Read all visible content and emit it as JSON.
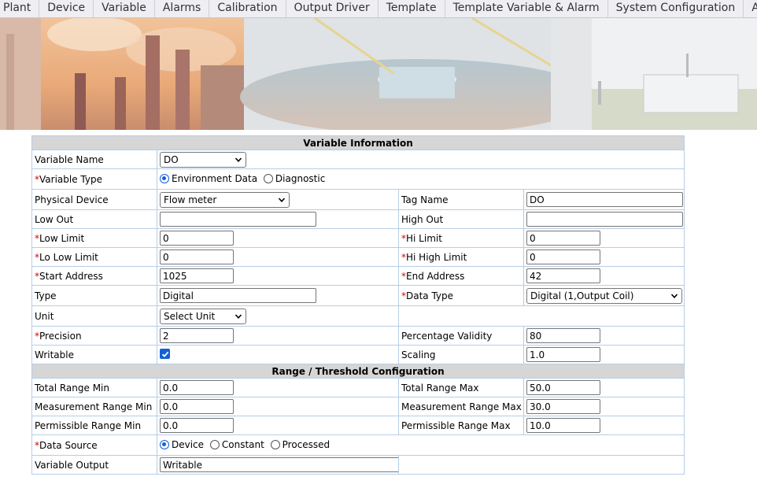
{
  "nav": {
    "items": [
      "Plant",
      "Device",
      "Variable",
      "Alarms",
      "Calibration",
      "Output Driver",
      "Template",
      "Template Variable & Alarm",
      "System Configuration",
      "Admin Con"
    ]
  },
  "sections": {
    "variable_info": "Variable Information",
    "range_threshold": "Range / Threshold Configuration"
  },
  "fields": {
    "variable_name": {
      "label": "Variable Name",
      "value": "DO"
    },
    "variable_type": {
      "label": "Variable Type",
      "options": [
        "Environment Data",
        "Diagnostic"
      ],
      "selected": "Environment Data"
    },
    "physical_device": {
      "label": "Physical Device",
      "value": "Flow meter"
    },
    "tag_name": {
      "label": "Tag Name",
      "value": "DO"
    },
    "low_out": {
      "label": "Low Out",
      "value": ""
    },
    "high_out": {
      "label": "High Out",
      "value": ""
    },
    "low_limit": {
      "label": "Low Limit",
      "value": "0"
    },
    "hi_limit": {
      "label": "Hi Limit",
      "value": "0"
    },
    "lo_low_limit": {
      "label": "Lo Low Limit",
      "value": "0"
    },
    "hi_high_limit": {
      "label": "Hi High Limit",
      "value": "0"
    },
    "start_address": {
      "label": "Start Address",
      "value": "1025"
    },
    "end_address": {
      "label": "End Address",
      "value": "42"
    },
    "type": {
      "label": "Type",
      "value": "Digital"
    },
    "data_type": {
      "label": "Data Type",
      "value": "Digital (1,Output Coil)"
    },
    "unit": {
      "label": "Unit",
      "value": "Select Unit"
    },
    "precision": {
      "label": "Precision",
      "value": "2"
    },
    "percentage_validity": {
      "label": "Percentage Validity",
      "value": "80"
    },
    "writable": {
      "label": "Writable",
      "checked": true
    },
    "scaling": {
      "label": "Scaling",
      "value": "1.0"
    },
    "total_range_min": {
      "label": "Total Range Min",
      "value": "0.0"
    },
    "total_range_max": {
      "label": "Total Range Max",
      "value": "50.0"
    },
    "measurement_range_min": {
      "label": "Measurement Range Min",
      "value": "0.0"
    },
    "measurement_range_max": {
      "label": "Measurement Range Max",
      "value": "30.0"
    },
    "permissible_range_min": {
      "label": "Permissible Range Min",
      "value": "0.0"
    },
    "permissible_range_max": {
      "label": "Permissible Range Max",
      "value": "10.0"
    },
    "data_source": {
      "label": "Data Source",
      "options": [
        "Device",
        "Constant",
        "Processed"
      ],
      "selected": "Device"
    },
    "variable_output": {
      "label": "Variable Output",
      "value": "Writable"
    }
  },
  "required_marker": "*",
  "icons": {
    "dropdown": "chevron-down-icon",
    "radio": "radio-icon",
    "checkbox": "checkmark-icon"
  },
  "colors": {
    "accent": "#1560d3",
    "required": "#dd0000",
    "section_bg": "#d6d6d6",
    "border": "#b7cde6"
  }
}
